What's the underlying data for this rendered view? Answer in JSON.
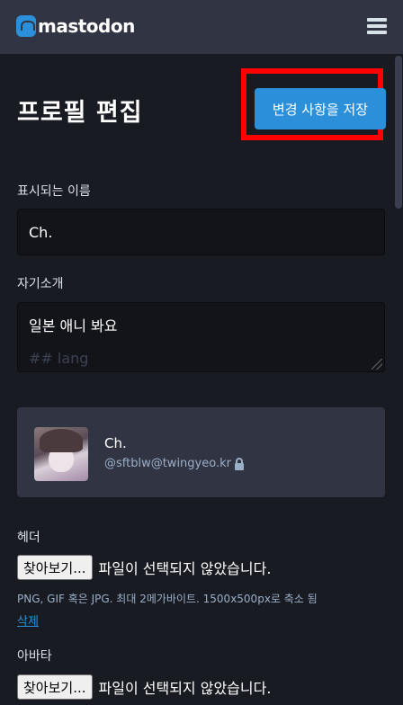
{
  "topbar": {
    "logo_text": "mastodon",
    "menu_icon": "hamburger-icon"
  },
  "page": {
    "title": "프로필 편집",
    "save_label": "변경 사항을 저장"
  },
  "form": {
    "display_name_label": "표시되는 이름",
    "display_name_value": "Ch.",
    "bio_label": "자기소개",
    "bio_line1": "일본 애니 봐요",
    "bio_line2": "## lang"
  },
  "profile_card": {
    "name": "Ch.",
    "handle": "@sftblw@twingyeo.kr",
    "lock_icon": "lock-icon"
  },
  "header_field": {
    "label": "헤더",
    "browse_label": "찾아보기...",
    "status": "파일이 선택되지 않았습니다.",
    "hint": "PNG, GIF 혹은 JPG. 최대 2메가바이트. 1500x500px로 축소 됨",
    "delete_label": "삭제"
  },
  "avatar_field": {
    "label": "아바타",
    "browse_label": "찾아보기...",
    "status": "파일이 선택되지 않았습니다."
  },
  "colors": {
    "background": "#191b22",
    "topbar": "#313543",
    "accent": "#2b90d9",
    "highlight": "#ff0000"
  }
}
